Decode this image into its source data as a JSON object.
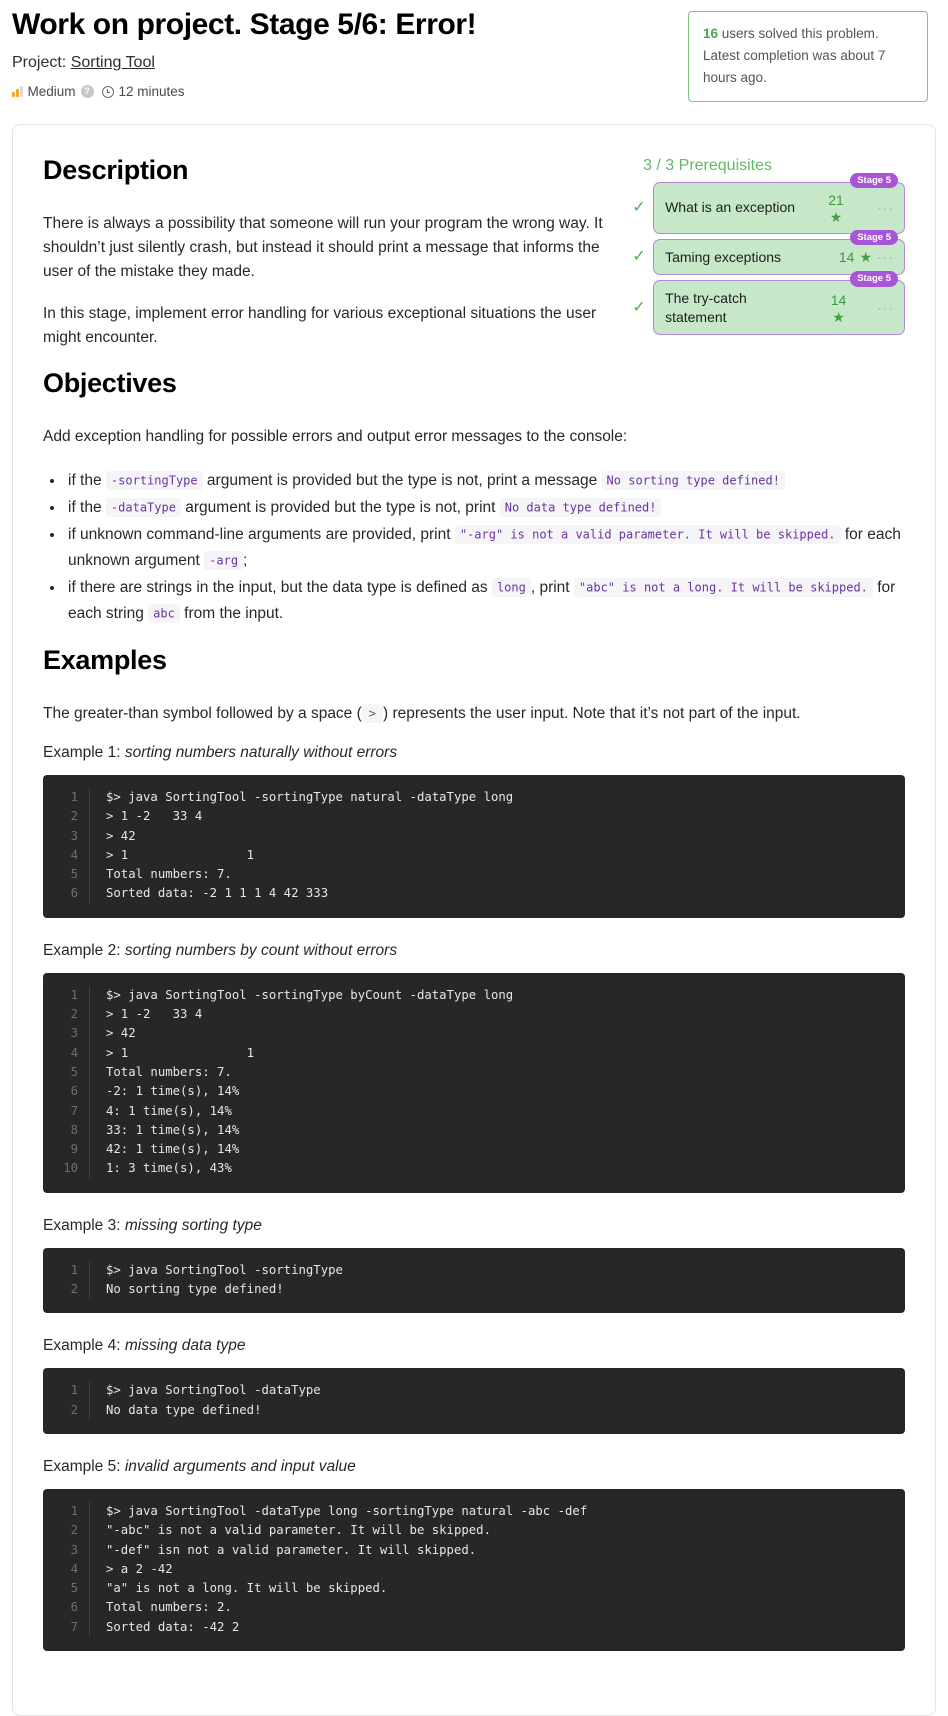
{
  "header": {
    "title": "Work on project. Stage 5/6: Error!",
    "project_prefix": "Project:",
    "project_name": "Sorting Tool",
    "difficulty": "Medium",
    "help_glyph": "?",
    "time": "12 minutes",
    "solved_count": "16",
    "solved_text": " users solved this problem. Latest completion was about 7 hours ago."
  },
  "description": {
    "heading": "Description",
    "p1": "There is always a possibility that someone will run your program the wrong way. It shouldn’t just silently crash, but instead it should print a message that informs the user of the mistake they made.",
    "p2": "In this stage, implement error handling for various exceptional situations the user might encounter."
  },
  "prerequisites": {
    "title": "3 / 3 Prerequisites",
    "check_glyph": "✓",
    "star_glyph": "★",
    "dots_glyph": "···",
    "items": [
      {
        "name": "What is an exception",
        "count": "21",
        "stage": "Stage 5"
      },
      {
        "name": "Taming exceptions",
        "count": "14",
        "stage": "Stage 5"
      },
      {
        "name": "The try-catch statement",
        "count": "14",
        "stage": "Stage 5"
      }
    ]
  },
  "objectives": {
    "heading": "Objectives",
    "intro": "Add exception handling for possible errors and output error messages to the console:",
    "bullets": [
      {
        "parts": [
          {
            "t": "text",
            "v": "if the "
          },
          {
            "t": "code",
            "v": "-sortingType"
          },
          {
            "t": "text",
            "v": " argument is provided but the type is not, print a message "
          },
          {
            "t": "code",
            "v": "No sorting type defined!"
          }
        ]
      },
      {
        "parts": [
          {
            "t": "text",
            "v": "if the "
          },
          {
            "t": "code",
            "v": "-dataType"
          },
          {
            "t": "text",
            "v": " argument is provided but the type is not, print "
          },
          {
            "t": "code",
            "v": "No data type defined!"
          }
        ]
      },
      {
        "parts": [
          {
            "t": "text",
            "v": "if unknown command-line arguments are provided, print "
          },
          {
            "t": "code",
            "v": "\"-arg\" is not a valid parameter. It will be skipped."
          },
          {
            "t": "text",
            "v": " for each unknown argument "
          },
          {
            "t": "code",
            "v": "-arg"
          },
          {
            "t": "text",
            "v": ";"
          }
        ]
      },
      {
        "parts": [
          {
            "t": "text",
            "v": "if there are strings in the input, but the data type is defined as "
          },
          {
            "t": "code",
            "v": "long"
          },
          {
            "t": "text",
            "v": ", print "
          },
          {
            "t": "code",
            "v": "\"abc\" is not a long. It will be skipped."
          },
          {
            "t": "text",
            "v": " for each string "
          },
          {
            "t": "code",
            "v": "abc"
          },
          {
            "t": "text",
            "v": " from the input."
          }
        ]
      }
    ]
  },
  "examples": {
    "heading": "Examples",
    "intro_before": "The greater-than symbol followed by a space (",
    "intro_code": ">",
    "intro_after": ") represents the user input. Note that it’s not part of the input.",
    "items": [
      {
        "label_prefix": "Example 1: ",
        "label_italic": "sorting numbers naturally without errors",
        "lines": [
          "$> java SortingTool -sortingType natural -dataType long",
          "> 1 -2   33 4",
          "> 42",
          "> 1                1",
          "Total numbers: 7.",
          "Sorted data: -2 1 1 1 4 42 333"
        ]
      },
      {
        "label_prefix": "Example 2: ",
        "label_italic": "sorting numbers by count without errors",
        "lines": [
          "$> java SortingTool -sortingType byCount -dataType long",
          "> 1 -2   33 4",
          "> 42",
          "> 1                1",
          "Total numbers: 7.",
          "-2: 1 time(s), 14%",
          "4: 1 time(s), 14%",
          "33: 1 time(s), 14%",
          "42: 1 time(s), 14%",
          "1: 3 time(s), 43%"
        ]
      },
      {
        "label_prefix": "Example 3: ",
        "label_italic": "missing sorting type",
        "lines": [
          "$> java SortingTool -sortingType",
          "No sorting type defined!"
        ]
      },
      {
        "label_prefix": "Example 4: ",
        "label_italic": "missing data type",
        "lines": [
          "$> java SortingTool -dataType",
          "No data type defined!"
        ]
      },
      {
        "label_prefix": "Example 5: ",
        "label_italic": "invalid arguments and input value",
        "lines": [
          "$> java SortingTool -dataType long -sortingType natural -abc -def",
          "\"-abc\" is not a valid parameter. It will be skipped.",
          "\"-def\" isn not a valid parameter. It will skipped.",
          "> a 2 -42",
          "\"a\" is not a long. It will be skipped.",
          "Total numbers: 2.",
          "Sorted data: -42 2"
        ]
      }
    ]
  },
  "colors": {
    "accent_green": "#4aa94e",
    "prereq_bg": "#c6e8c8",
    "prereq_border": "#b089d8",
    "stage_badge": "#a855d8",
    "code_bg": "#272727",
    "inline_code_text": "#6b33a3",
    "difficulty_bar": "#f5a623"
  }
}
